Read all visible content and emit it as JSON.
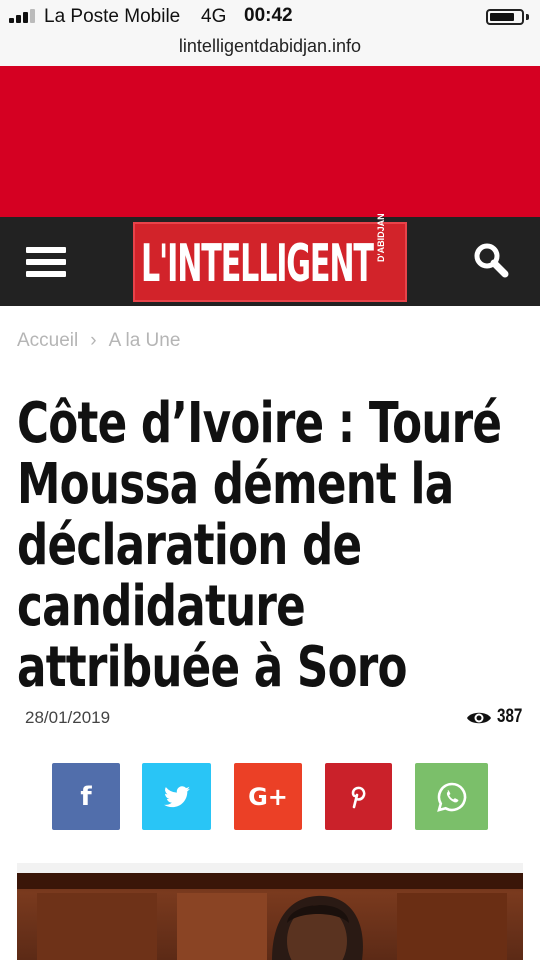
{
  "status_bar": {
    "carrier": "La Poste Mobile",
    "network": "4G",
    "time": "00:42",
    "battery_level": 0.8
  },
  "browser": {
    "url": "lintelligentdabidjan.info"
  },
  "header": {
    "logo_text": "L'INTELLIGENT",
    "logo_subtext": "D'ABIDJAN",
    "menu_icon": "hamburger-menu-icon",
    "search_icon": "search-icon",
    "background": "#222222",
    "logo_color": "#d2232a"
  },
  "ad_banner": {
    "color": "#d50022"
  },
  "breadcrumb": {
    "home": "Accueil",
    "separator": "›",
    "category": "A la Une"
  },
  "article": {
    "title": "Côte d’Ivoire : Touré Moussa dément la déclaration de candidature attribuée à Soro",
    "date": "28/01/2019",
    "views": "387",
    "views_icon": "eye-icon"
  },
  "share": [
    {
      "network": "facebook",
      "icon": "facebook-icon",
      "color": "#516eab"
    },
    {
      "network": "twitter",
      "icon": "twitter-icon",
      "color": "#29c5f6"
    },
    {
      "network": "google-plus",
      "icon": "google-plus-icon",
      "color": "#eb4026"
    },
    {
      "network": "pinterest",
      "icon": "pinterest-icon",
      "color": "#ca212a"
    },
    {
      "network": "whatsapp",
      "icon": "whatsapp-icon",
      "color": "#7bbf6a"
    }
  ]
}
